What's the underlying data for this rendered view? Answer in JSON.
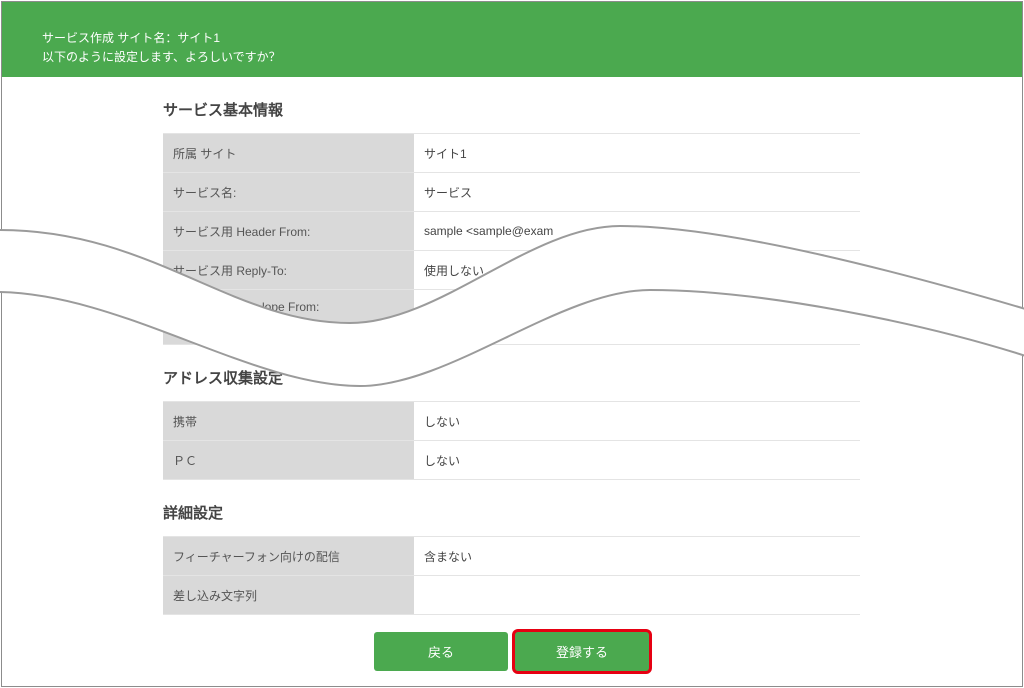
{
  "header": {
    "title": "サービス作成 サイト名：サイト1",
    "message": "以下のように設定します、よろしいですか？"
  },
  "sections": [
    {
      "heading": "サービス基本情報",
      "rows": [
        {
          "label": "所属 サイト",
          "value": "サイト1"
        },
        {
          "label": "サービス名:",
          "value": "サービス"
        },
        {
          "label": "サービス用 Header From:",
          "value": "sample <sample@exam"
        },
        {
          "label": "サービス用 Reply-To:",
          "value": "使用しない"
        },
        {
          "label": "lope From:",
          "value": ""
        }
      ]
    },
    {
      "heading": "アドレス収集設定",
      "rows": [
        {
          "label": "携帯",
          "value": "しない"
        },
        {
          "label": "ＰＣ",
          "value": "しない"
        }
      ]
    },
    {
      "heading": "詳細設定",
      "rows": [
        {
          "label": "フィーチャーフォン向けの配信",
          "value": "含まない"
        },
        {
          "label": "差し込み文字列",
          "value": ""
        }
      ]
    }
  ],
  "buttons": {
    "back": "戻る",
    "register": "登録する"
  },
  "colors": {
    "accent_green": "#4ba94f",
    "highlight_red": "#e60012",
    "label_bg": "#d9d9d9"
  }
}
